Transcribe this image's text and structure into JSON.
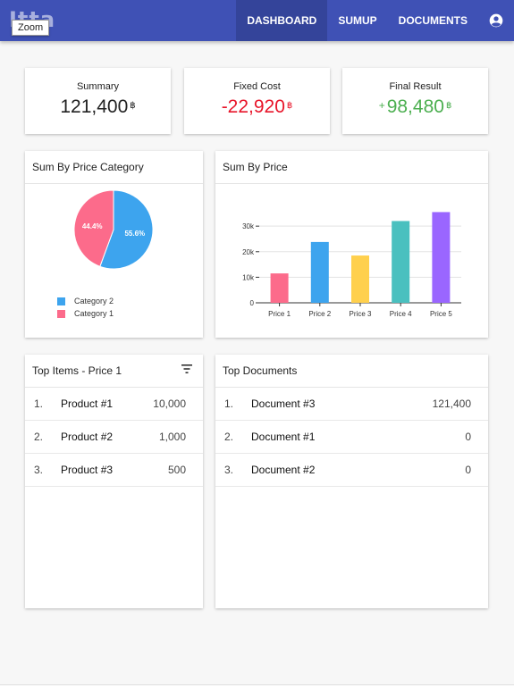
{
  "app": {
    "logo_text": "Itta",
    "tooltip": "Zoom"
  },
  "nav": {
    "tabs": [
      {
        "label": "DASHBOARD",
        "active": true
      },
      {
        "label": "SUMUP",
        "active": false
      },
      {
        "label": "DOCUMENTS",
        "active": false
      }
    ],
    "account_icon": "account-circle-icon"
  },
  "stats": [
    {
      "label": "Summary",
      "value": "121,400",
      "currency": "฿",
      "prefix": "",
      "color": "#222222"
    },
    {
      "label": "Fixed Cost",
      "value": "-22,920",
      "currency": "฿",
      "prefix": "",
      "color": "#e8152a"
    },
    {
      "label": "Final Result",
      "value": "98,480",
      "currency": "฿",
      "prefix": "+",
      "color": "#4caf50"
    }
  ],
  "pie_card": {
    "title": "Sum By Price Category",
    "chart_data": {
      "type": "pie",
      "slices": [
        {
          "name": "Category 2",
          "value": 55.6,
          "label": "55.6%",
          "color": "#3da4ee"
        },
        {
          "name": "Category 1",
          "value": 44.4,
          "label": "44.4%",
          "color": "#fc6b8b"
        }
      ],
      "legend": "bottom-left"
    }
  },
  "bar_card": {
    "title": "Sum By Price",
    "chart_data": {
      "type": "bar",
      "categories": [
        "Price 1",
        "Price 2",
        "Price 3",
        "Price 4",
        "Price 5"
      ],
      "values": [
        11500,
        23800,
        18500,
        32000,
        35500
      ],
      "colors": [
        "#fc6b8b",
        "#3da4ee",
        "#ffd04d",
        "#4ac0bf",
        "#9a66ff"
      ],
      "yticks": [
        0,
        10000,
        20000,
        30000
      ],
      "ytick_labels": [
        "0",
        "10k",
        "20k",
        "30k"
      ],
      "ylim": [
        0,
        36000
      ],
      "grid": true
    }
  },
  "top_items": {
    "title": "Top Items - Price 1",
    "filter_icon": "filter-icon",
    "rows": [
      {
        "index": "1.",
        "name": "Product #1",
        "value": "10,000"
      },
      {
        "index": "2.",
        "name": "Product #2",
        "value": "1,000"
      },
      {
        "index": "3.",
        "name": "Product #3",
        "value": "500"
      }
    ]
  },
  "top_documents": {
    "title": "Top Documents",
    "rows": [
      {
        "index": "1.",
        "name": "Document #3",
        "value": "121,400"
      },
      {
        "index": "2.",
        "name": "Document #1",
        "value": "0"
      },
      {
        "index": "3.",
        "name": "Document #2",
        "value": "0"
      }
    ]
  }
}
